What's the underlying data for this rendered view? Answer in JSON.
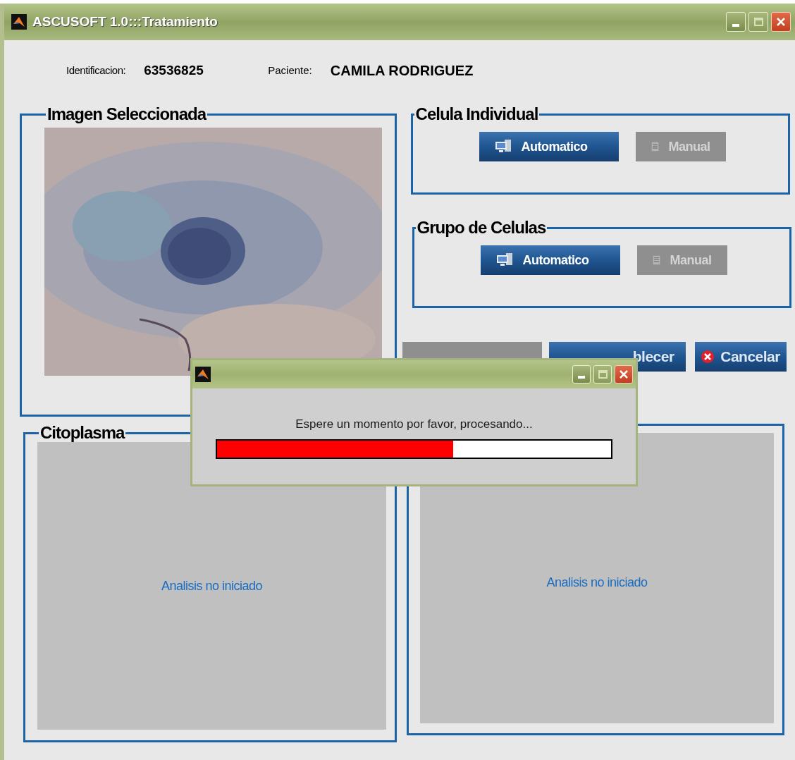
{
  "window": {
    "title": "ASCUSOFT 1.0:::Tratamiento"
  },
  "patient": {
    "id_label": "Identificacion:",
    "id": "63536825",
    "name_label": "Paciente:",
    "name": "CAMILA RODRIGUEZ"
  },
  "image_panel": {
    "title": "Imagen Seleccionada"
  },
  "cell_groups": [
    {
      "title": "Celula Individual",
      "buttons": [
        {
          "label": "Automatico",
          "kind": "auto",
          "disabled": false
        },
        {
          "label": "Manual",
          "kind": "manual",
          "disabled": true
        }
      ]
    },
    {
      "title": "Grupo de Celulas",
      "buttons": [
        {
          "label": "Automatico",
          "kind": "auto",
          "disabled": false
        },
        {
          "label": "Manual",
          "kind": "manual",
          "disabled": true
        }
      ]
    }
  ],
  "actions": [
    {
      "kind": "plain",
      "disabled": true
    },
    {
      "kind": "plain",
      "label": "blecer",
      "disabled": false
    },
    {
      "kind": "cancel",
      "label": "Cancelar",
      "disabled": false
    }
  ],
  "result_panels": [
    {
      "title": "Citoplasma",
      "status": "Analisis no iniciado"
    },
    {
      "status": "Analisis no iniciado"
    }
  ],
  "dialog": {
    "message": "Espere un momento por favor, procesando...",
    "progress": {
      "level": 0.6
    }
  }
}
